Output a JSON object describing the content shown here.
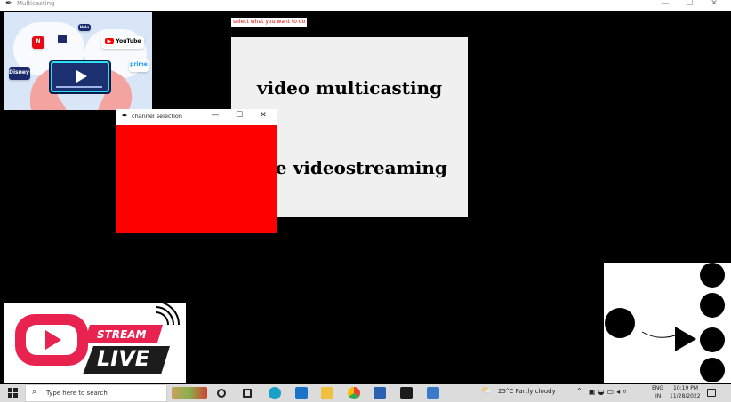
{
  "window": {
    "title": "Multicasting",
    "controls": [
      "—",
      "☐",
      "✕"
    ]
  },
  "thumbnail": {
    "logos": [
      "N",
      "YouTube",
      "prime",
      "Disney+",
      "Hulu"
    ]
  },
  "prompt": "select what you want to do",
  "options": [
    "video multicasting",
    "live videostreaming"
  ],
  "popup": {
    "title": "channel selection",
    "controls": [
      "—",
      "☐",
      "✕"
    ]
  },
  "live_badge": {
    "line1": "STREAM",
    "line2": "LIVE"
  },
  "taskbar": {
    "search_placeholder": "Type here to search",
    "weather": "25°C  Partly cloudy",
    "language": "ENG",
    "region": "IN",
    "time": "10:19 PM",
    "date": "11/28/2022"
  }
}
